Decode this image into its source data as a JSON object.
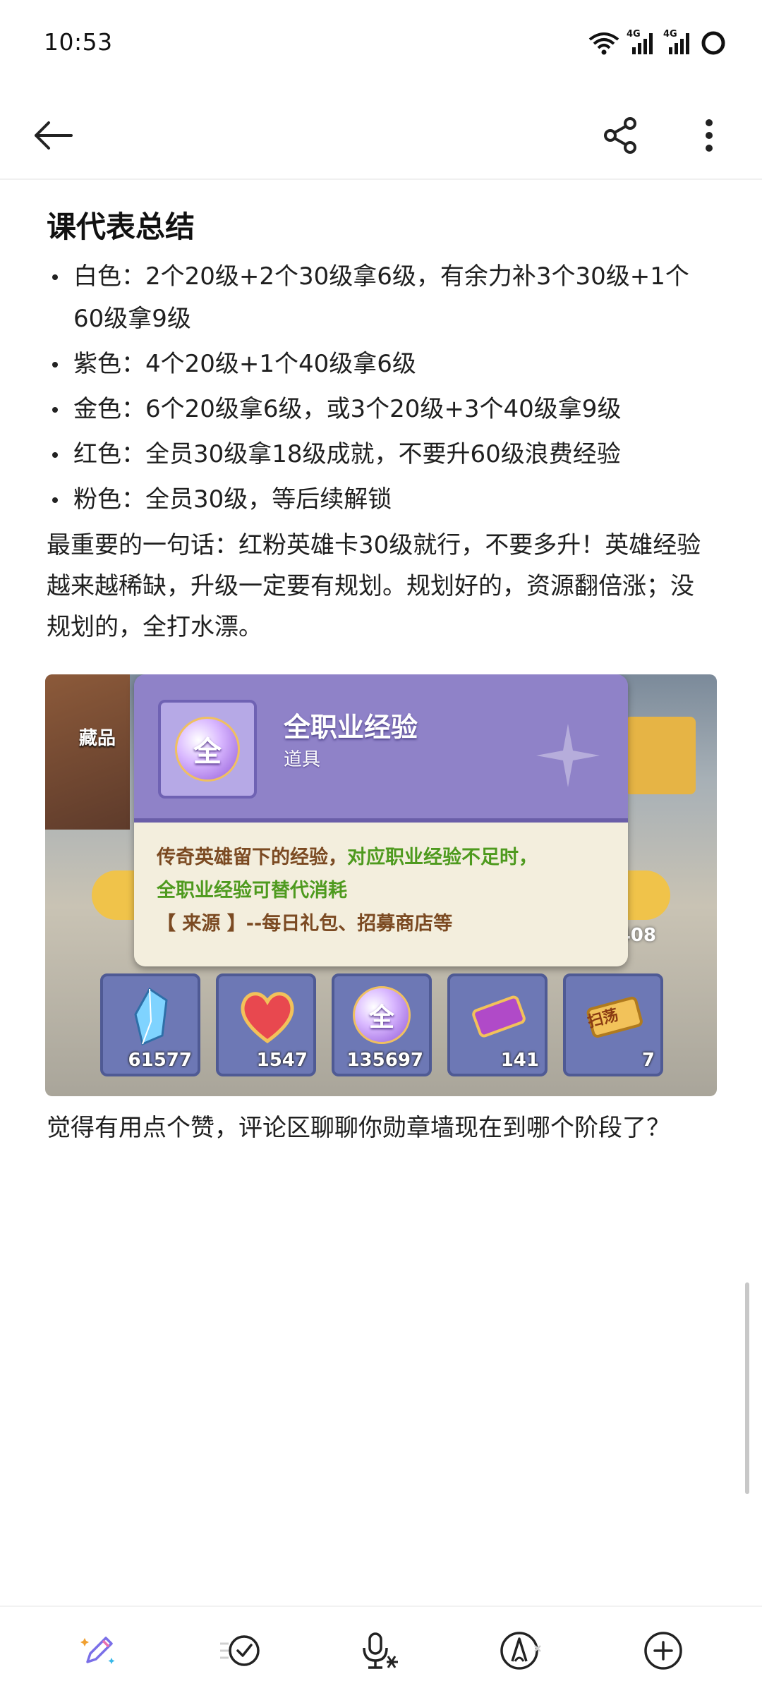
{
  "status_bar": {
    "time": "10:53",
    "icons": [
      "wifi-icon",
      "signal-4g-icon",
      "signal-4g-icon",
      "battery-ring-icon"
    ],
    "network_label_1": "4G",
    "network_label_2": "4G"
  },
  "app_bar": {
    "back_icon": "arrow-left-icon",
    "share_icon": "share-icon",
    "more_icon": "more-vertical-icon"
  },
  "article": {
    "heading": "课代表总结",
    "bullets": [
      "白色：2个20级+2个30级拿6级，有余力补3个30级+1个60级拿9级",
      "紫色：4个20级+1个40级拿6级",
      "金色：6个20级拿6级，或3个20级+3个40级拿9级",
      "红色：全员30级拿18级成就，不要升60级浪费经验",
      "粉色：全员30级，等后续解锁"
    ],
    "paragraph": "最重要的一句话：红粉英雄卡30级就行，不要多升！英雄经验越来越稀缺，升级一定要有规划。规划好的，资源翻倍涨；没规划的，全打水漂。",
    "footer": "觉得有用点个赞，评论区聊聊你勋章墙现在到哪个阶段了？"
  },
  "game_screenshot": {
    "left_label": "藏品",
    "popup_icon_text": "全",
    "popup_title": "全职业经验",
    "popup_subtitle": "道具",
    "desc_part1": "传奇英雄留下的经验，",
    "desc_part2": "对应职业经验不足时，",
    "desc_part3": "全职业经验可替代消耗",
    "desc_source": "【 来源 】--每日礼包、招募商店等",
    "background_count": "408",
    "items": [
      {
        "icon": "crystal-icon",
        "count": "61577"
      },
      {
        "icon": "heart-icon",
        "count": "1547"
      },
      {
        "icon": "all-class-exp-orb-icon",
        "glyph": "全",
        "count": "135697"
      },
      {
        "icon": "ticket-purple-icon",
        "count": "141"
      },
      {
        "icon": "sweep-ticket-icon",
        "glyph": "扫荡",
        "count": "7"
      }
    ]
  },
  "bottom_toolbar": {
    "icons": [
      "ai-pen-sparkle-icon",
      "checklist-icon",
      "voice-to-text-icon",
      "handwriting-icon",
      "add-circle-icon"
    ]
  },
  "colors": {
    "popup_header": "#8f82c8",
    "popup_body": "#f3eedd",
    "desc_green": "#4e9a1e",
    "desc_brown": "#7b4a22",
    "item_slot": "#6d78b5"
  }
}
